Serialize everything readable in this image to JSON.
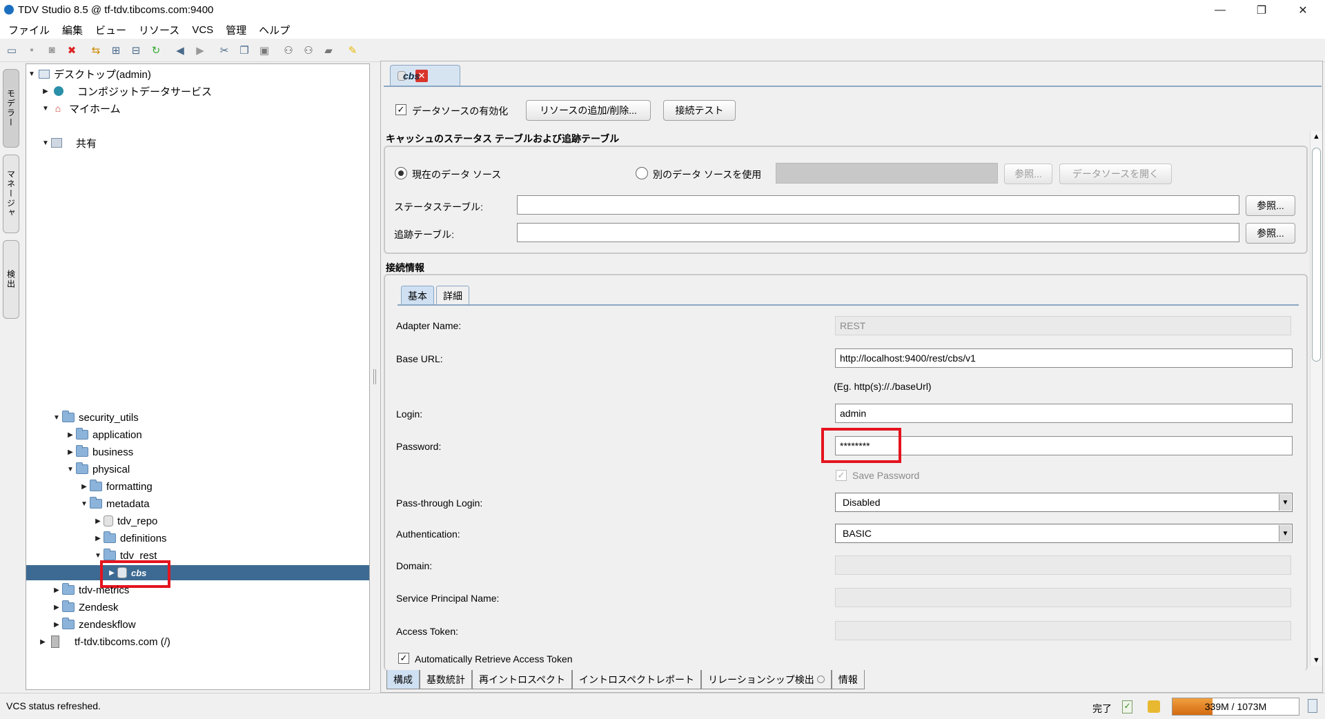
{
  "window": {
    "title": "TDV Studio 8.5 @ tf-tdv.tibcoms.com:9400",
    "minimize": "—",
    "restore": "❐",
    "close": "✕"
  },
  "menu": [
    "ファイル",
    "編集",
    "ビュー",
    "リソース",
    "VCS",
    "管理",
    "ヘルプ"
  ],
  "toolbar_icons": [
    "open-icon",
    "save-icon",
    "save-all-icon",
    "delete-icon",
    "move-icon",
    "expand-icon",
    "collapse-icon",
    "refresh-icon",
    "back-icon",
    "forward-icon",
    "cut-icon",
    "copy-icon",
    "paste-icon",
    "find-icon",
    "find-next-icon",
    "bookmark-icon",
    "note-icon"
  ],
  "side_tabs": [
    "モデラー",
    "マネージャ",
    "検出"
  ],
  "tree": {
    "desktop": "デスクトップ(admin)",
    "composite": "コンポジットデータサービス",
    "myhome": "マイホーム",
    "shared": "共有",
    "security_utils": "security_utils",
    "application": "application",
    "business": "business",
    "physical": "physical",
    "formatting": "formatting",
    "metadata": "metadata",
    "tdv_repo": "tdv_repo",
    "definitions": "definitions",
    "tdv_rest": "tdv_rest",
    "cbs": "cbs",
    "tdv_metrics": "tdv-metrics",
    "zendesk": "Zendesk",
    "zendeskflow": "zendeskflow",
    "server": "tf-tdv.tibcoms.com (/)"
  },
  "editor": {
    "tab_label": "cbs",
    "tab_close": "✕",
    "enable_datasource": "データソースの有効化",
    "enable_checked": true,
    "add_remove_button": "リソースの追加/削除...",
    "test_connection_button": "接続テスト",
    "cache_section_title": "キャッシュのステータス テーブルおよび追跡テーブル",
    "radio_current": "現在のデータ ソース",
    "radio_other": "別のデータ ソースを使用",
    "browse_disabled": "参照...",
    "open_datasource_disabled": "データソースを開く",
    "status_table_label": "ステータステーブル:",
    "status_table_value": "",
    "tracking_table_label": "追跡テーブル:",
    "tracking_table_value": "",
    "browse": "参照...",
    "connection_section_title": "接続情報",
    "subtab_basic": "基本",
    "subtab_advanced": "詳細",
    "fields": {
      "adapter_name_label": "Adapter Name:",
      "adapter_name_value": "REST",
      "base_url_label": "Base URL:",
      "base_url_value": "http://localhost:9400/rest/cbs/v1",
      "base_url_hint": "(Eg. http(s)://./baseUrl)",
      "login_label": "Login:",
      "login_value": "admin",
      "password_label": "Password:",
      "password_value": "********",
      "save_password_label": "Save Password",
      "passthrough_label": "Pass-through Login:",
      "passthrough_value": "Disabled",
      "authentication_label": "Authentication:",
      "authentication_value": "BASIC",
      "domain_label": "Domain:",
      "domain_value": "",
      "spn_label": "Service Principal Name:",
      "spn_value": "",
      "access_token_label": "Access Token:",
      "access_token_value": "",
      "auto_retrieve_label": "Automatically Retrieve Access Token"
    },
    "bottom_tabs": [
      "構成",
      "基数統計",
      "再イントロスペクト",
      "イントロスペクトレポート",
      "リレーションシップ検出",
      "情報"
    ]
  },
  "status": {
    "message": "VCS status refreshed.",
    "done": "完了",
    "memory_text": "339M / 1073M",
    "memory_fraction": 0.316,
    "colors": {
      "selection": "#3d6a92",
      "highlight": "#e4141e",
      "memory": "#e0801e"
    }
  }
}
